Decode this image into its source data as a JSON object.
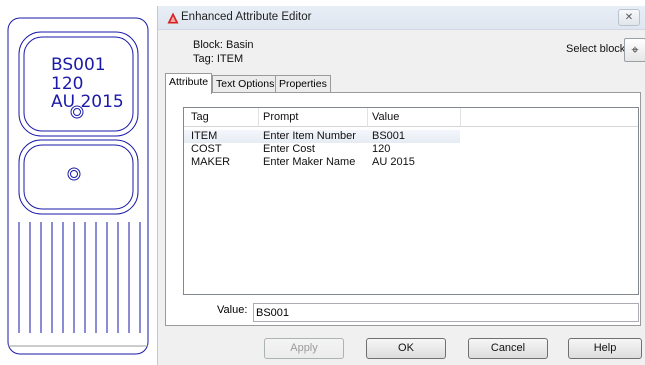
{
  "drawing": {
    "attributes": [
      "BS001",
      "120",
      "AU 2015"
    ],
    "line_color": "#1a1aa8"
  },
  "dialog": {
    "title": "Enhanced Attribute Editor",
    "close_icon": "close-icon",
    "block_label": "Block: Basin",
    "tag_label": "Tag: ITEM",
    "select_block_label": "Select block",
    "tabs": [
      {
        "label": "Attribute",
        "active": true
      },
      {
        "label": "Text Options",
        "active": false
      },
      {
        "label": "Properties",
        "active": false
      }
    ],
    "list": {
      "columns": [
        "Tag",
        "Prompt",
        "Value"
      ],
      "rows": [
        {
          "tag": "ITEM",
          "prompt": "Enter Item Number",
          "value": "BS001",
          "selected": true
        },
        {
          "tag": "COST",
          "prompt": "Enter Cost",
          "value": "120",
          "selected": false
        },
        {
          "tag": "MAKER",
          "prompt": "Enter Maker Name",
          "value": "AU 2015",
          "selected": false
        }
      ]
    },
    "value_label": "Value:",
    "value_text": "BS001",
    "buttons": {
      "apply": "Apply",
      "ok": "OK",
      "cancel": "Cancel",
      "help": "Help"
    }
  }
}
